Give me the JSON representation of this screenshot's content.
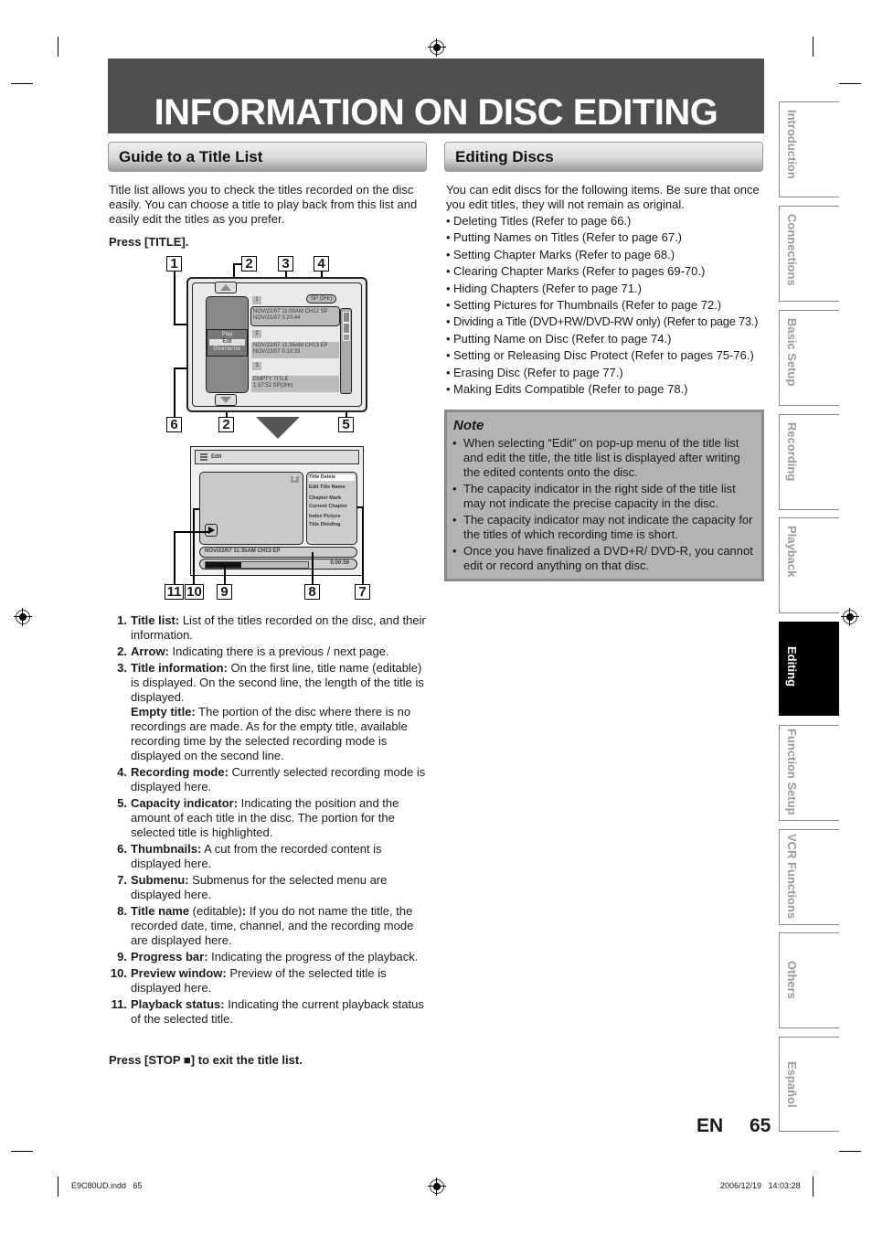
{
  "page": {
    "title": "INFORMATION ON DISC EDITING",
    "language_code": "EN",
    "page_number": "65"
  },
  "left_section": {
    "heading": "Guide to a Title List",
    "intro": "Title list allows you to check the titles recorded on the disc easily. You can choose a title to play back from this list and easily edit the titles as you prefer.",
    "press_instruction": "Press [TITLE].",
    "items": [
      {
        "num": "1.",
        "term": "Title list:",
        "text": " List of the titles recorded on the disc, and their information."
      },
      {
        "num": "2.",
        "term": "Arrow:",
        "text": " Indicating there is a previous / next page."
      },
      {
        "num": "3.",
        "term": "Title information:",
        "text": " On the first line, title name (editable) is displayed. On the second line, the length of the title is displayed.",
        "extra_term": "Empty title:",
        "extra_text": " The portion of the disc where there is no recordings are made. As for the empty title, available recording time by the selected recording mode is displayed on the second line."
      },
      {
        "num": "4.",
        "term": "Recording mode:",
        "text": " Currently selected recording mode is displayed here."
      },
      {
        "num": "5.",
        "term": "Capacity indicator:",
        "text": " Indicating the position and the amount of each title in the disc. The portion for the selected title is highlighted."
      },
      {
        "num": "6.",
        "term": "Thumbnails:",
        "text": " A cut from the recorded content is displayed here."
      },
      {
        "num": "7.",
        "term": "Submenu:",
        "text": " Submenus for the selected menu are displayed here."
      },
      {
        "num": "8.",
        "term": "Title name",
        "text_plain": " (editable)",
        "term2": ":",
        "text": " If you do not name the title, the recorded date, time, channel, and the recording mode are displayed here."
      },
      {
        "num": "9.",
        "term": "Progress bar:",
        "text": " Indicating the progress of the playback."
      },
      {
        "num": "10.",
        "term": "Preview window:",
        "text": " Preview of the selected title is displayed here."
      },
      {
        "num": "11.",
        "term": "Playback status:",
        "text": " Indicating the current playback status of the selected title."
      }
    ],
    "exit_instruction_pre": "Press [STOP ",
    "exit_instruction_icon": "■",
    "exit_instruction_post": "] to exit the title list."
  },
  "diagram_title_list": {
    "callouts": [
      "1",
      "2",
      "3",
      "4",
      "6",
      "2",
      "5"
    ],
    "recording_mode": "SP (2Hr)",
    "popup_menu": [
      "Play",
      "Edit",
      "Overwrite"
    ],
    "popup_selected": "Edit",
    "titles": [
      {
        "index": "1",
        "line1": "NOV/21/07  11:00AM CH12 SP",
        "line2": "NOV/21/07    0:20:44"
      },
      {
        "index": "2",
        "line1": "NOV/22/07  11:35AM CH13 EP",
        "line2": "NOV/22/07    0:10:33"
      },
      {
        "index": "3",
        "line1": "EMPTY TITLE",
        "line2": "1:37:52  SP(2Hr)"
      }
    ]
  },
  "diagram_edit": {
    "header_label": "Edit",
    "preview_index": "2",
    "submenu": [
      "Title Delete",
      "Edit Title Name",
      "Chapter Mark",
      "Current Chapter",
      "Index Picture",
      "Title Dividing"
    ],
    "submenu_selected": "Title Delete",
    "title_name": "NOV/22/07 11:35AM CH13 EP",
    "elapsed_time": "0:00:59",
    "progress_fraction": 0.35,
    "callouts": [
      "11",
      "10",
      "9",
      "8",
      "7"
    ]
  },
  "right_section": {
    "heading": "Editing Discs",
    "intro": "You can edit discs for the following items. Be sure that once you edit titles, they will not remain as original.",
    "items": [
      "Deleting Titles (Refer to page 66.)",
      "Putting Names on Titles (Refer to page 67.)",
      "Setting Chapter Marks (Refer to page 68.)",
      "Clearing Chapter Marks (Refer to pages 69-70.)",
      "Hiding Chapters (Refer to page 71.)",
      "Setting Pictures for Thumbnails (Refer to page 72.)",
      "Dividing a Title (DVD+RW/DVD-RW only) (Refer to page 73.)",
      "Putting Name on Disc (Refer to page 74.)",
      "Setting or Releasing Disc Protect (Refer to pages 75-76.)",
      "Erasing Disc (Refer to page 77.)",
      "Making Edits Compatible (Refer to page 78.)"
    ],
    "note": {
      "heading": "Note",
      "items": [
        "When selecting “Edit” on pop-up menu of the title list and edit the title, the title list is displayed after writing the edited contents onto the disc.",
        "The capacity indicator in the right side of the title list may not indicate the precise capacity in the disc.",
        "The capacity indicator may not indicate the capacity for the titles of which recording time is short.",
        "Once you have finalized a DVD+R/ DVD-R, you cannot edit or record anything on that disc."
      ]
    }
  },
  "side_tabs": [
    {
      "label": "Introduction",
      "active": false
    },
    {
      "label": "Connections",
      "active": false
    },
    {
      "label": "Basic Setup",
      "active": false
    },
    {
      "label": "Recording",
      "active": false
    },
    {
      "label": "Playback",
      "active": false
    },
    {
      "label": "Editing",
      "active": true
    },
    {
      "label": "Function Setup",
      "active": false
    },
    {
      "label": "VCR Functions",
      "active": false
    },
    {
      "label": "Others",
      "active": false
    },
    {
      "label": "Español",
      "active": false
    }
  ],
  "print_footer": {
    "file": "E9C80UD.indd   65",
    "timestamp": "2006/12/19   14:03:28"
  },
  "colors": {
    "header_band": "#4f4f4f",
    "note_bg": "#b3b3b3",
    "active_tab": "#000000",
    "inactive_tab_text": "#9a9a9a"
  }
}
